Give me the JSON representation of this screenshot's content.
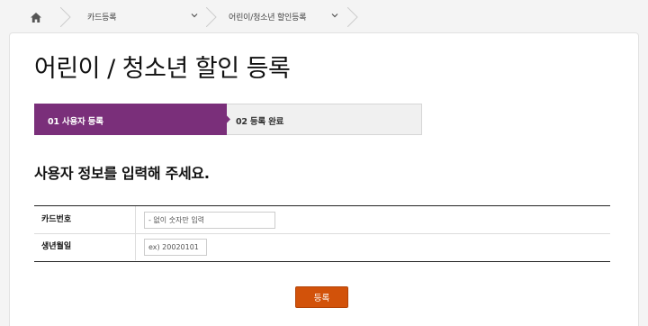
{
  "breadcrumb": {
    "items": [
      {
        "label": "카드등록"
      },
      {
        "label": "어린이/청소년 할인등록"
      }
    ]
  },
  "page": {
    "title": "어린이 / 청소년 할인 등록"
  },
  "steps": [
    {
      "label": "01 사용자 등록",
      "active": true
    },
    {
      "label": "02 등록 완료",
      "active": false
    }
  ],
  "section": {
    "title": "사용자 정보를 입력해 주세요."
  },
  "form": {
    "card_number": {
      "label": "카드번호",
      "placeholder": "- 없이 숫자만 입력"
    },
    "birth_date": {
      "label": "생년월일",
      "placeholder": "ex) 20020101"
    }
  },
  "submit_label": "등록",
  "colors": {
    "accent_step": "#7a2f7a",
    "submit_button": "#d2520a"
  }
}
